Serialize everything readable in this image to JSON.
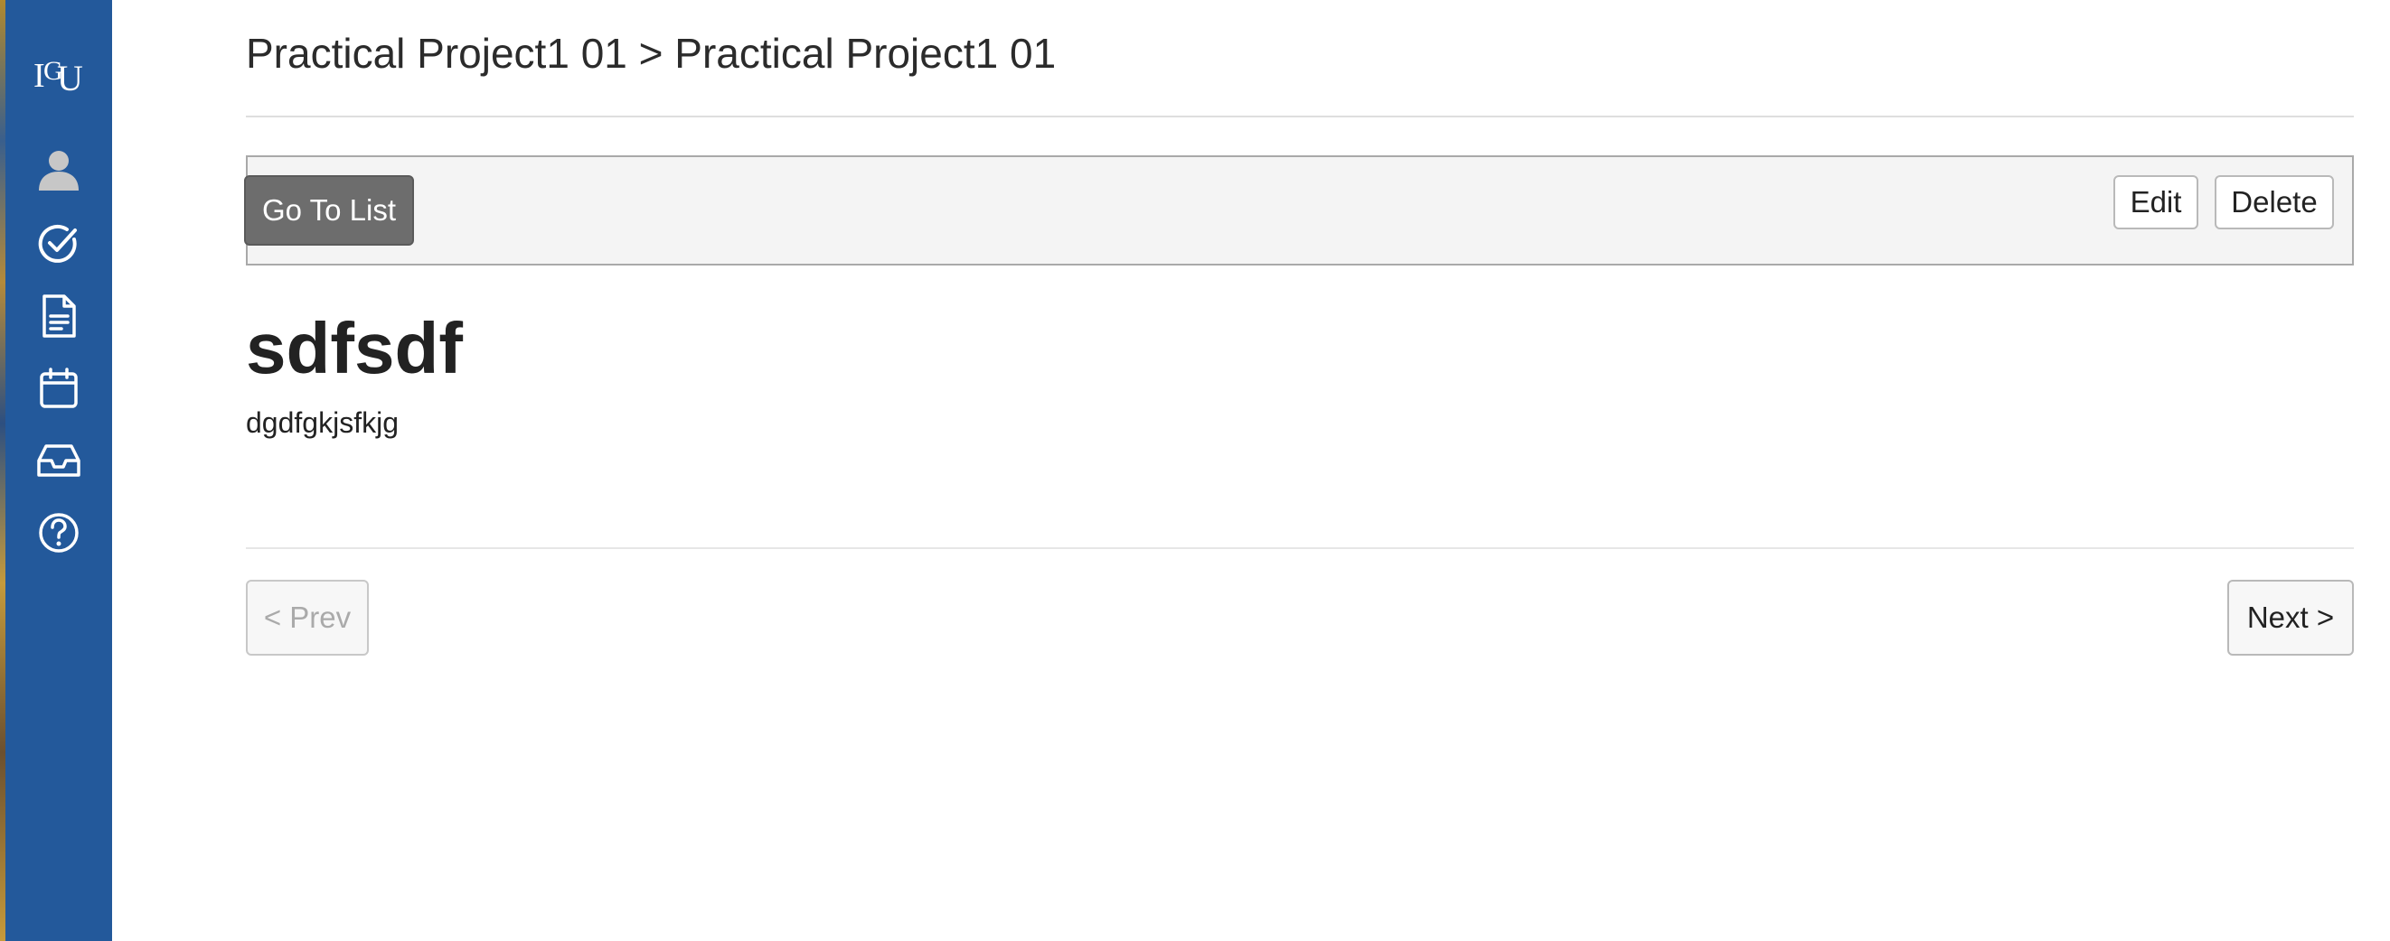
{
  "sidebar": {
    "logo_text": "IGU",
    "items": [
      {
        "icon": "user-icon"
      },
      {
        "icon": "check-circle-icon"
      },
      {
        "icon": "document-icon"
      },
      {
        "icon": "calendar-icon"
      },
      {
        "icon": "inbox-icon"
      },
      {
        "icon": "help-circle-icon"
      }
    ],
    "colors": {
      "background": "#23599b",
      "icon": "#ffffff",
      "user_icon": "#c7c7c7"
    }
  },
  "header": {
    "breadcrumb": "Practical Project1 01 > Practical Project1 01"
  },
  "toolbar": {
    "go_to_list_label": "Go To List",
    "edit_label": "Edit",
    "delete_label": "Delete"
  },
  "post": {
    "title": "sdfsdf",
    "body": "dgdfgkjsfkjg"
  },
  "pagination": {
    "prev_label": "< Prev",
    "next_label": "Next >"
  }
}
